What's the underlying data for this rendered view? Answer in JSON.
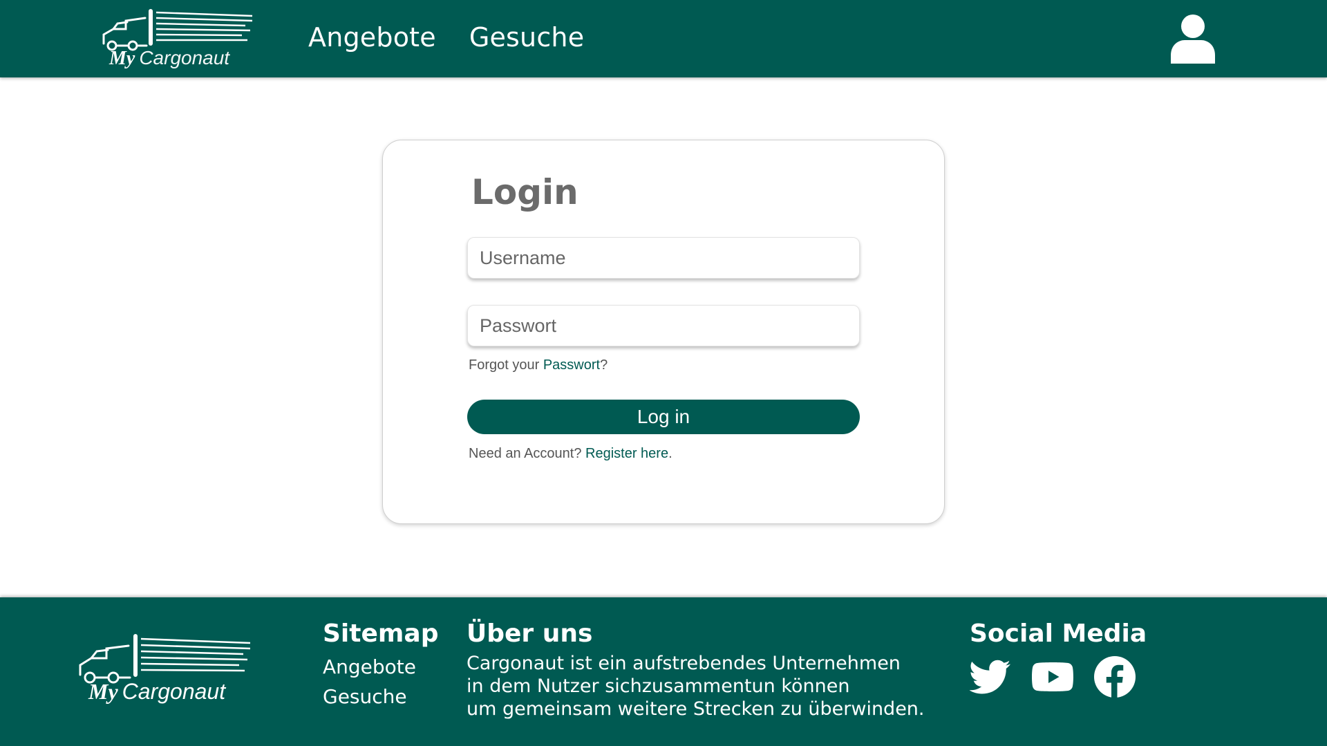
{
  "brand": {
    "logo_prefix": "My",
    "logo_name": "Cargonaut"
  },
  "nav": {
    "items": [
      {
        "label": "Angebote"
      },
      {
        "label": "Gesuche"
      }
    ]
  },
  "header": {
    "user_icon": "user-icon"
  },
  "login": {
    "title": "Login",
    "username_placeholder": "Username",
    "password_placeholder": "Passwort",
    "forgot_prefix": "Forgot your ",
    "forgot_link": "Passwort",
    "forgot_suffix": "?",
    "button_label": "Log in",
    "register_prefix": "Need an Account? ",
    "register_link": "Register here",
    "register_suffix": "."
  },
  "footer": {
    "sitemap": {
      "title": "Sitemap",
      "links": [
        {
          "label": "Angebote"
        },
        {
          "label": "Gesuche"
        }
      ]
    },
    "about": {
      "title": "Über uns",
      "lines": [
        "Cargonaut ist ein aufstrebendes Unternehmen",
        "in dem Nutzer sichzusammentun können",
        "um gemeinsam weitere Strecken zu überwinden."
      ]
    },
    "social": {
      "title": "Social Media",
      "icons": [
        "twitter-icon",
        "youtube-icon",
        "facebook-icon"
      ]
    }
  },
  "colors": {
    "primary": "#005a52",
    "title_gray": "#6b6b6b"
  }
}
